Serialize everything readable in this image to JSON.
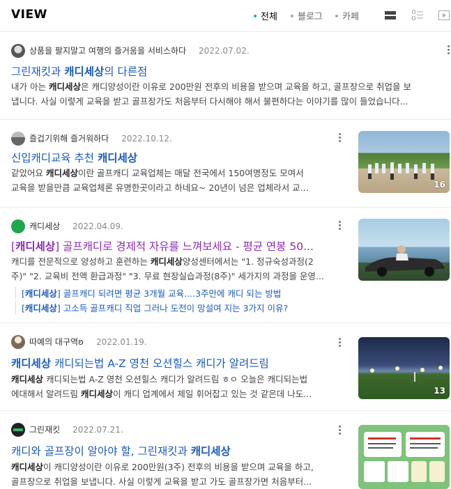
{
  "header": {
    "title": "VIEW",
    "filters": [
      {
        "label": "전체",
        "active": true
      },
      {
        "label": "블로그",
        "active": false
      },
      {
        "label": "카페",
        "active": false
      }
    ]
  },
  "results": [
    {
      "author": "상품을 팔지말고 여행의 즐거움을 서비스하다",
      "date": "2022.07.02.",
      "title_parts": [
        "그린재킷과 ",
        "캐디세상",
        "의 다른점"
      ],
      "snippet_line1": [
        "내가 아는 ",
        "캐디세상",
        "은 캐디양성이란 이유로 200만원 전후의 비용을 받으며 교육을 하고, 골프장으로 취업을 보"
      ],
      "snippet_line2": "냅니다. 사실 이렇게 교육을 받고 골프장가도 처음부터 다시해야 해서 불편하다는 이야기를 많이 들었습니다..."
    },
    {
      "author": "즐겁기위해 즐거워하다",
      "date": "2022.10.12.",
      "title_parts": [
        "신입캐디교육 추천 ",
        "캐디세상",
        ""
      ],
      "snippet_line1": [
        "같았어요 ",
        "캐디세상",
        "이란 골프캐디 교육업체는 매달 전국에서 150여명정도 모여서"
      ],
      "snippet_line2": "교육을 받을만큼 교육업체론 유명한곳이라고 하네요~ 20년이 넘은 업체라서 교...",
      "thumb_count": "16"
    },
    {
      "author": "캐디세상",
      "date": "2022.04.09.",
      "title_parts": [
        "[",
        "캐디세상",
        "] 골프캐디로 경제적 자유를 느껴보세요 - 평균 연봉 50..."
      ],
      "snippet_line1": [
        "캐디를 전문적으로 양성하고 훈련하는 ",
        "캐디세상",
        "양성센터에서는 \"1. 정규숙성과정(2"
      ],
      "snippet_line2": "주)\" \"2. 교육비 전액 환급과정\" \"3. 무료 현장실습과정(8주)\" 세가지의 과정을 운영...",
      "sub_links": [
        [
          "[",
          "캐디세상",
          "] 골프캐디 되려면 평균 3개월 교육....3주만에 캐디 되는 방법"
        ],
        [
          "[",
          "캐디세상",
          "] 고소득 골프캐디 직업 그러나 도전이 망설여 지는 3가지 이유?"
        ]
      ]
    },
    {
      "author": "따예의 대구역ʚ",
      "date": "2022.01.19.",
      "title_parts": [
        "",
        "캐디세상",
        " 캐디되는법 A-Z 영천 오션힐스 캐디가 알려드림"
      ],
      "snippet_line1": [
        "",
        "캐디세상",
        " 캐디되는법 A-Z 영천 오션힐스 캐디가 알려드림 ㅎㅇ 오늘은 캐디되는법"
      ],
      "snippet_line2_parts": [
        "에대해서 알려드림 ",
        "캐디세상",
        "이 캐디 업계에서 제일 휘어잡고 있는 것 같은데 나도..."
      ],
      "thumb_count": "13"
    },
    {
      "author": "그린재킷",
      "date": "2022.07.21.",
      "title_parts": [
        "캐디와 골프장이 알아야 할, 그린재킷과 ",
        "캐디세상",
        ""
      ],
      "snippet_line1": [
        "",
        "캐디세상",
        "이 캐디양성이란 이유로 200만원(3주) 전후의 비용을 받으며 교육을 하고,"
      ],
      "snippet_line2": "골프장으로 취업을 보냅니다. 사실 이렇게 교육을 받고 가도 골프장가면 처음부터...",
      "avatar_text": "GREEN JACKET"
    }
  ],
  "colors": {
    "link": "#1a5abd",
    "visited": "#8a2ab5",
    "active_dot": "#03c75a"
  }
}
